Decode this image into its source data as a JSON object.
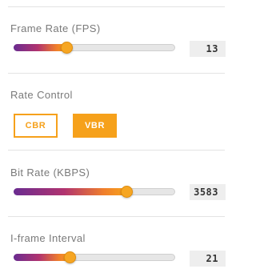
{
  "frame_rate": {
    "label": "Frame Rate (FPS)",
    "value": "13",
    "level_percent": 33
  },
  "rate_control": {
    "label": "Rate Control",
    "options": [
      "CBR",
      "VBR"
    ],
    "selected": "VBR"
  },
  "bit_rate": {
    "label": "Bit Rate (KBPS)",
    "value": "3583",
    "level_percent": 70
  },
  "iframe_interval": {
    "label": "I-frame Interval",
    "value": "21",
    "level_percent": 35
  },
  "colors": {
    "accent": "#f6a11b",
    "gradient_start": "#6a2c91",
    "gradient_mid": "#b1336f",
    "gradient_end": "#f7a21c"
  }
}
